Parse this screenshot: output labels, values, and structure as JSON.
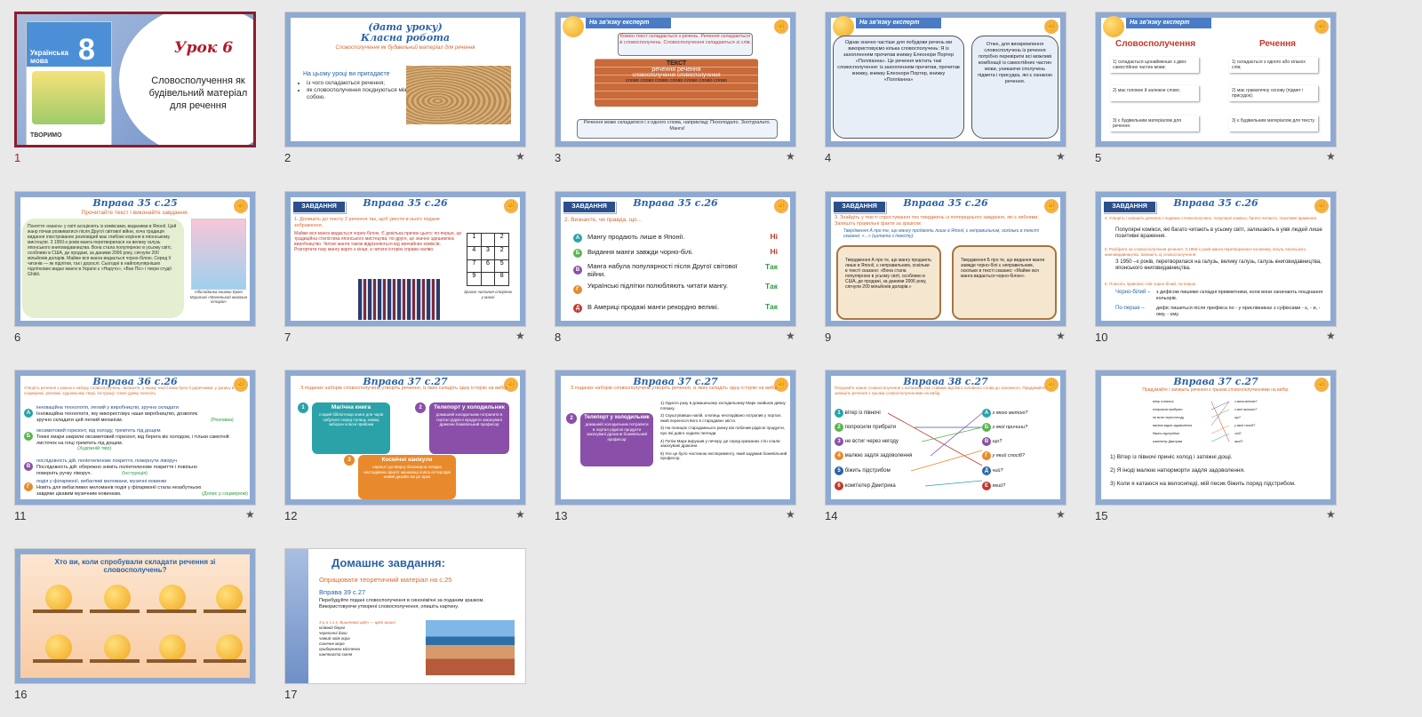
{
  "slides": [
    {
      "number": "1",
      "title": "Урок 6",
      "subtitle": "Словосполучення як будівельний матеріал для речення",
      "book_title": "Українська мова",
      "book_grade": "8",
      "book_footer": "ТВОРИМО"
    },
    {
      "number": "2",
      "title1": "(дата уроку)",
      "title2": "Класна робота",
      "subtitle": "Словосполучення як будівельний матеріал для речення",
      "lead": "На цьому уроці ви пригадаєте",
      "bullets": [
        "із чого складаються речення;",
        "як словосполучення поєднуються між собою."
      ]
    },
    {
      "number": "3",
      "banner": "На зв'язку експерт",
      "box_top": "Кожен текст складається з речень. Речення складаються зі словосполучень. Словосполучення складаються зі слів.",
      "wall_lines": [
        "ТЕКСТ",
        "речення речення",
        "словосполучення словосполучення",
        "слово слово слово слово слово слово слово"
      ],
      "box_bottom": "Речення може складатися і з одного слова, наприклад: Похолодало. Зоотуральто. Манга!"
    },
    {
      "number": "4",
      "banner": "На зв'язку експерт",
      "left_text": "Однак значно частіше для побудови речень ми використовуємо кілька словосполучень: Я із захопленням прочитав книжку Елеонори Портер «Полліанна». Це речення містить такі словосполучення: із захопленням прочитав, прочитав книжку, книжку Елеонори Портер, книжку «Полліанна»",
      "right_text": "Отже, для виокремлення словосполучень із речення потрібно перевірити всі можливі комбінації із самостійних частин мови, уникаючи сполучень підмета і присудка, які є ознакою речення."
    },
    {
      "number": "5",
      "banner": "На зв'язку експерт",
      "left_head": "Словосполучення",
      "right_head": "Речення",
      "left_notes": [
        "1) складається щонайменше з двох самостійних частин мови;",
        "2) має головне й залежне слово;",
        "3) є будівельним матеріалом для речення."
      ],
      "right_notes": [
        "1) складається з одного або кількох слів;",
        "2) має граматичну основу (підмет і присудок);",
        "3) є будівельним матеріалом для тексту."
      ]
    },
    {
      "number": "6",
      "title": "Вправа 35 с.25",
      "subtitle": "Прочитайте текст і виконайте завдання.",
      "text": "Поняття «манга» у світі асоціюють із коміксами, виданими в Японії. Цей жанр почав розвиватися після Другої світової війни, хоча традиція видання ілюстрованих розповідей має глибоке коріння в японському мистецтві. З 1950-х років манга перетворилася на велику галузь японського книговидавництва. Вона стала популярною в усьому світі, особливо в США, де продажі, за даними 2006 року, сягнули 200 мільйонів доларів. Майже вся манга видається чорно-білою. Серед її читачів — як підлітки, так і дорослі. Сьогодні в найпопулярніших підліткових видах манги в Україні є «Наруто», «Ван Піс» і твори студії Ghibli.",
      "caption": "Обкладинка книжки Еріко Мурасакі «Маленький магазин історій»"
    },
    {
      "number": "7",
      "badge": "ЗАВДАННЯ",
      "title": "Вправа 35 с.26",
      "task": "1. Допишіть до тексту 2 речення так, щоб увести в нього подане зображення.",
      "text": "Майже вся манга видається чорно-білою. Є декілька причин цього: по-перше, це традиційна стилістика японського мистецтва; по-друге, це значно здешевлює виробництво. Читачі манги також відрізняються від звичайних коміксів. Розгортати таку мангу варто з кінця, а читати історію справа наліво.",
      "grid_caption": "Зразок читання сторінок у манзі",
      "grid_cells": [
        "1",
        "",
        "2",
        "4",
        "3",
        "2",
        "7",
        "6",
        "5",
        "9",
        "",
        "8"
      ]
    },
    {
      "number": "8",
      "badge": "ЗАВДАННЯ",
      "title": "Вправа 35 с.26",
      "task": "2. Визначте, чи правда, що...",
      "rows": [
        {
          "letter": "А",
          "text": "Мангу продають лише в Японії.",
          "answer": "Ні"
        },
        {
          "letter": "Б",
          "text": "Видання манги завжди чорно-білі.",
          "answer": "Ні"
        },
        {
          "letter": "В",
          "text": "Манга набула популярності після Другої світової війни.",
          "answer": "Так"
        },
        {
          "letter": "Г",
          "text": "Українські підлітки полюбляють читати мангу.",
          "answer": "Так"
        },
        {
          "letter": "Д",
          "text": "В Америці продажі манги рекордно великі.",
          "answer": "Так"
        }
      ]
    },
    {
      "number": "9",
      "badge": "ЗАВДАННЯ",
      "title": "Вправа 35 с.26",
      "task": "3. Знайдіть у тексті спростування тих тверджень із попереднього завдання, які є хибними. Запишіть правильні факти за зразком:",
      "example": "Твердження А про те, що мангу продають лише в Японії, є неправильним, оскільки в тексті сказано: «...» (цитата з тексту).",
      "scroll_left": "Твердження А про те, що мангу продають лише в Японії, є неправильним, оскільки в тексті сказано: «Вона стала популярною в усьому світі, особливо в США, де продажі, за даними 2006 року, сягнули 200 мільйонів доларів.»",
      "scroll_right": "Твердження Б про те, що видання манги завжди чорно-білі є неправильним, оскільки в тексті сказано: «Майже вся манга видається чорно-білою»."
    },
    {
      "number": "10",
      "badge": "ЗАВДАННЯ",
      "title": "Вправа 35 с.26",
      "task4": "4. Утворіть і запишіть речення з поданих словосполучень: популярні комікси, багато читають, позитивні враження.",
      "answer4": "Популярні комікси, які багато читають в усьому світі, залишають в уяві людей лише позитивні враження.",
      "task5": "5. Розібрати на словосполучення речення: З 1950-х років манга перетворилася на велику галузь японського книговидавництва. Запишіть ці словосполучення.",
      "answer5": "З 1950 –х років, перетворилася на галузь, велику галузь, галузь книговидавництва, японського книговидавництва.",
      "task6": "6. Поясніть правопис слів чорно-білий, по-перше.",
      "answer6a_term": "Чорно-білий –",
      "answer6a": "з дефісом пишемо складні прикметники, коли вони означають поєднання кольорів.",
      "answer6b_term": "По-перше –",
      "answer6b": "дефіс пишеться після префікса по - у прислівниках з суфіксами - є, - и, - ому, - єму."
    },
    {
      "number": "11",
      "title": "Вправа 36 с.26",
      "task": "Утворіть речення з кожного набору словосполучень і визначте, у якому тексті вони були б доречними: у допису в соцмережі, рекламі, художньому творі, інструкції. Свою думку поясніть.",
      "rows": [
        {
          "letter": "А",
          "head": "інноваційна технологія, легкий у виробництві, зручна складати",
          "body": "Інноваційна технологія, яку використовує наше виробництво, дозволяє зручно складати цей легкий механізм.",
          "tag": "(Реклама)"
        },
        {
          "letter": "Б",
          "head": "оксамитовий горизонт, від холоду, тремтить під дощем",
          "body": "Темні хмари закрили оксамитовий горизонт, від берега віє холодом, і тільки самотній листочок на гілці тремтить під дощем.",
          "tag": "(Художній твір)"
        },
        {
          "letter": "В",
          "head": "послідовність дій, поліетиленове покриття, повернути ліворуч",
          "body": "Послідовність дій: обережно зніміть поліетиленове покриття і повільно поверніть ручку ліворуч.",
          "tag": "(Інструкція)"
        },
        {
          "letter": "Г",
          "head": "подія у філармонії, вибагливі меломани, музичні новинки",
          "body": "Новіть для вибагливих меломанів подія у філармонії стала незабутньою завдяки цікавим музичним новинкам.",
          "tag": "(Допис у соцмережі)"
        }
      ]
    },
    {
      "number": "12",
      "title": "Вправа 37 с.27",
      "task": "З поданих наборів словосполучень утворіть речення, із яких складіть одну історію на вибір.",
      "cards": [
        {
          "num": "1",
          "head": "Магічна книга",
          "body": "старий бібліотекар книги для чарів забулися серед полиць знавці заборон класні прийоми"
        },
        {
          "num": "2",
          "head": "Телепорт у холодильник",
          "body": "домашній холодильник потрапити в портал рідкісні продукти закохувані дракони божевільний професор"
        },
        {
          "num": "3",
          "head": "Космічні канікули",
          "body": "нарешті до Марсу безхмарна поїздка несподівана зіроліт мешканці пояса астероїдів новий дизайн аж до зірок"
        }
      ]
    },
    {
      "number": "13",
      "title": "Вправа 37 с.27",
      "task": "З поданих наборів словосполучень утворіть речення, із яких складіть одну історію на вибір.",
      "card_num": "2",
      "card_head": "Телепорт у холодильник",
      "card_body": "домашній холодильник потрапити в портал рідкісні продукти закохувані дракони божевільний професор",
      "story": [
        "1) Одного разу в домашньому холодильнику Марк знайшов дивну пляшку.",
        "2) Скуштувавши напій, хлопець несподівано потрапив у портал, який перенісся його в стародавнє місто.",
        "3) На полицях стародавнього ринку він побачив рідкісні продукти, про які довго ходили легенди.",
        "4) Потім Марк вирушив у печеру, де серед крижаних стін спали закохувані дракони.",
        "5) Усе це було частиною експерименту, який задумав божевільний професор."
      ]
    },
    {
      "number": "14",
      "title": "Вправа 38 с.27",
      "task": "Поєднайте кожне словосполучення з питанням, яке ставимо від його головного слова до залежного. Придумайте і запишіть речення з трьома словосполученнями на вибір.",
      "left": [
        "вітер із півночі",
        "попросили прибрати",
        "не встиг через негоду",
        "малюю задля задоволення",
        "біжить підстрибом",
        "комп'ютер Дмитрика"
      ],
      "right_letters": [
        "А",
        "Б",
        "В",
        "Г",
        "Д",
        "Е"
      ],
      "right": [
        "з якою метою?",
        "з якої причини?",
        "що?",
        "у який спосіб?",
        "чий?",
        "який?"
      ]
    },
    {
      "number": "15",
      "title": "Вправа 37 с.27",
      "task": "Придумайте і запишіть речення з трьома словосполученнями на вибір.",
      "left": [
        "вітер із півночі",
        "попросили прибрати",
        "не встиг через негоду",
        "малюю задля задоволення",
        "біжить підстрибом",
        "комп'ютер Дмитрика"
      ],
      "right": [
        "з якою метою?",
        "з якої причини?",
        "що?",
        "у який спосіб?",
        "чий?",
        "який?"
      ],
      "sentences": [
        "1) Вітер із півночі приніс холод і затяжні дощі.",
        "2) Я іноді малюю натюрморти задля задоволення.",
        "3) Коли я катаюся на велосипеді, мій песик біжить поряд підстрибом."
      ]
    },
    {
      "number": "16",
      "title": "Хто ви, коли спробували складати речення зі словосполучень?"
    },
    {
      "number": "17",
      "title": "Домашнє завдання:",
      "line1": "Опрацювати теоретичний матеріал на с.25",
      "line2": "Вправа 39 с.27",
      "line3": "Перебудуйте подані словосполучення в синонімічні за поданим зразком. Використовуючи утворені словосполучення, опишіть картину.",
      "list": [
        "З р а з о к. Вишневий цвіт — цвіт вишні",
        "кілімній берег",
        "черепичні дахи",
        "чаїний зойк гора",
        "сонячне море",
        "прибережна містечко",
        "кам'яниста скеля"
      ]
    }
  ],
  "star_label": "★",
  "colors": {
    "selected_border": "#8b1d2c",
    "title_blue": "#2b63a8",
    "accent_orange": "#d9682b"
  }
}
